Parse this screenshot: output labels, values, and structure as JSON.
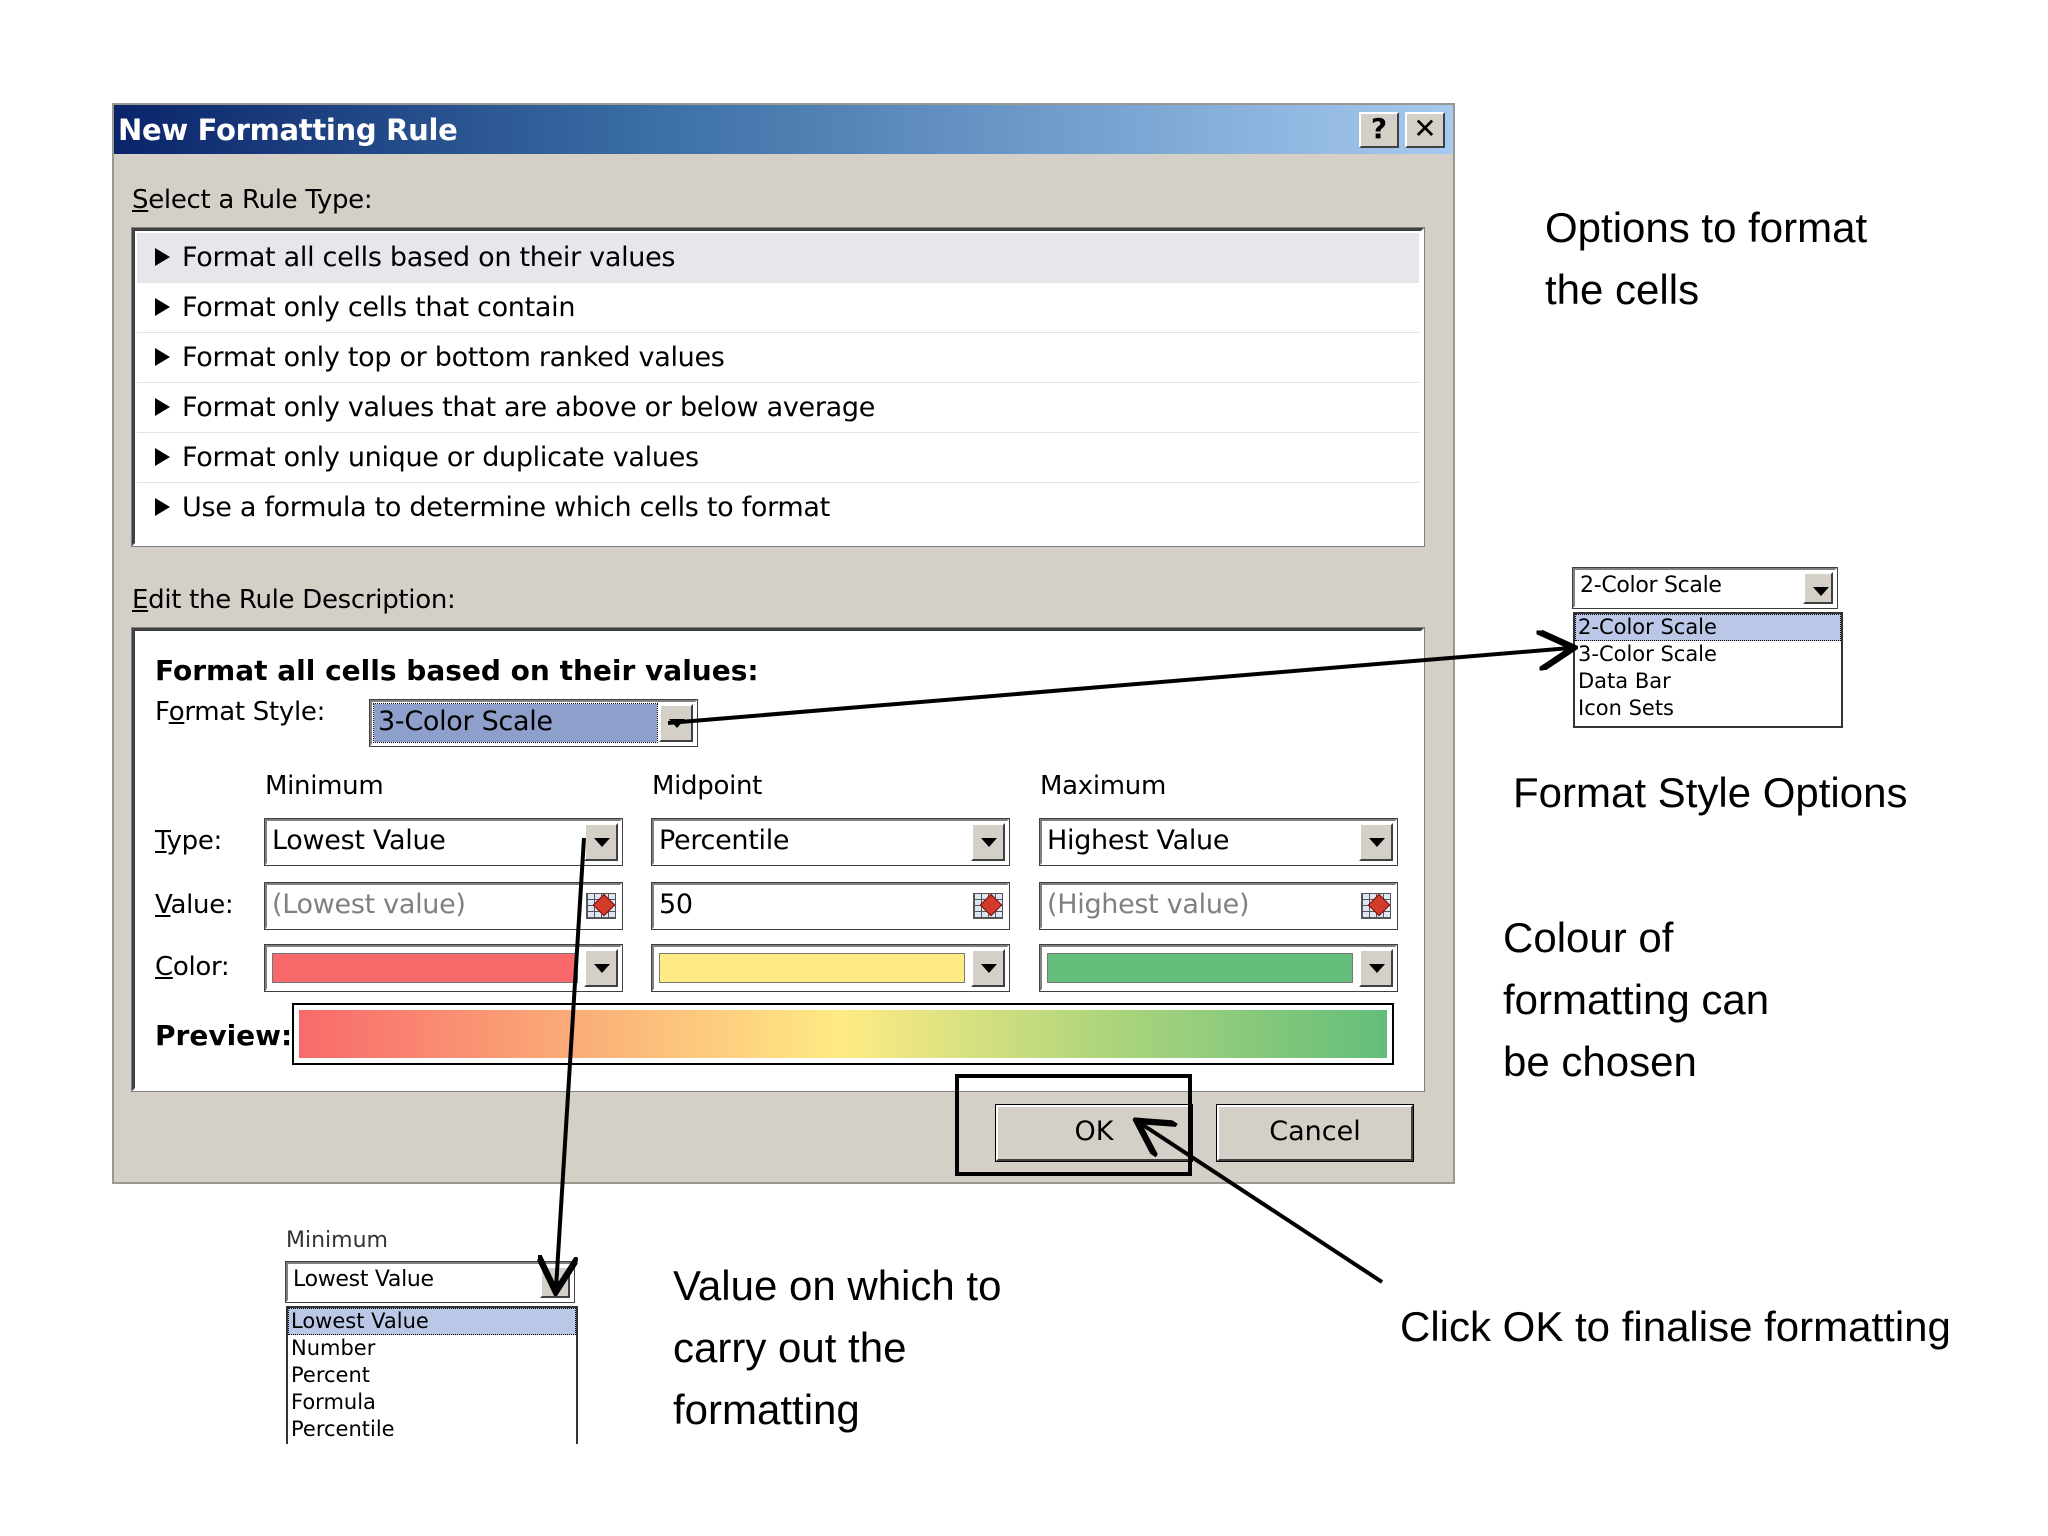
{
  "dialog": {
    "title": "New Formatting Rule",
    "help_label": "?",
    "close_label": "✕",
    "select_rule_type_label": {
      "u": "S",
      "rest": "elect a Rule Type:"
    },
    "rule_types": [
      "Format all cells based on their values",
      "Format only cells that contain",
      "Format only top or bottom ranked values",
      "Format only values that are above or below average",
      "Format only unique or duplicate values",
      "Use a formula to determine which cells to format"
    ],
    "edit_rule_label": {
      "u": "E",
      "rest": "dit the Rule Description:"
    },
    "description": {
      "heading": "Format all cells based on their values:",
      "format_style_label": {
        "pre": "F",
        "u": "o",
        "rest": "rmat Style:"
      },
      "format_style_value": "3-Color Scale",
      "columns": {
        "minimum": "Minimum",
        "midpoint": "Midpoint",
        "maximum": "Maximum"
      },
      "row_labels": {
        "type": {
          "u": "T",
          "rest": "ype:"
        },
        "value": {
          "u": "V",
          "rest": "alue:"
        },
        "color": {
          "u": "C",
          "rest": "olor:"
        }
      },
      "minimum": {
        "type": "Lowest Value",
        "value": "(Lowest value)",
        "color": "#f8696b"
      },
      "midpoint": {
        "type": "Percentile",
        "value": "50",
        "color": "#ffeb84"
      },
      "maximum": {
        "type": "Highest Value",
        "value": "(Highest value)",
        "color": "#63be7b"
      },
      "preview_label": "Preview:"
    },
    "ok_label": "OK",
    "cancel_label": "Cancel"
  },
  "format_style_dropdown": {
    "selected": "2-Color Scale",
    "options": [
      "2-Color Scale",
      "3-Color Scale",
      "Data Bar",
      "Icon Sets"
    ]
  },
  "minimum_dropdown": {
    "label": "Minimum",
    "selected": "Lowest Value",
    "options": [
      "Lowest Value",
      "Number",
      "Percent",
      "Formula",
      "Percentile"
    ]
  },
  "annotations": {
    "options_cells": [
      "Options to format",
      "the cells"
    ],
    "format_style_options": "Format Style Options",
    "colour": [
      "Colour of",
      "formatting can",
      "be chosen"
    ],
    "value": [
      "Value on which to",
      "carry out the",
      "formatting"
    ],
    "click_ok": "Click OK to finalise formatting"
  }
}
